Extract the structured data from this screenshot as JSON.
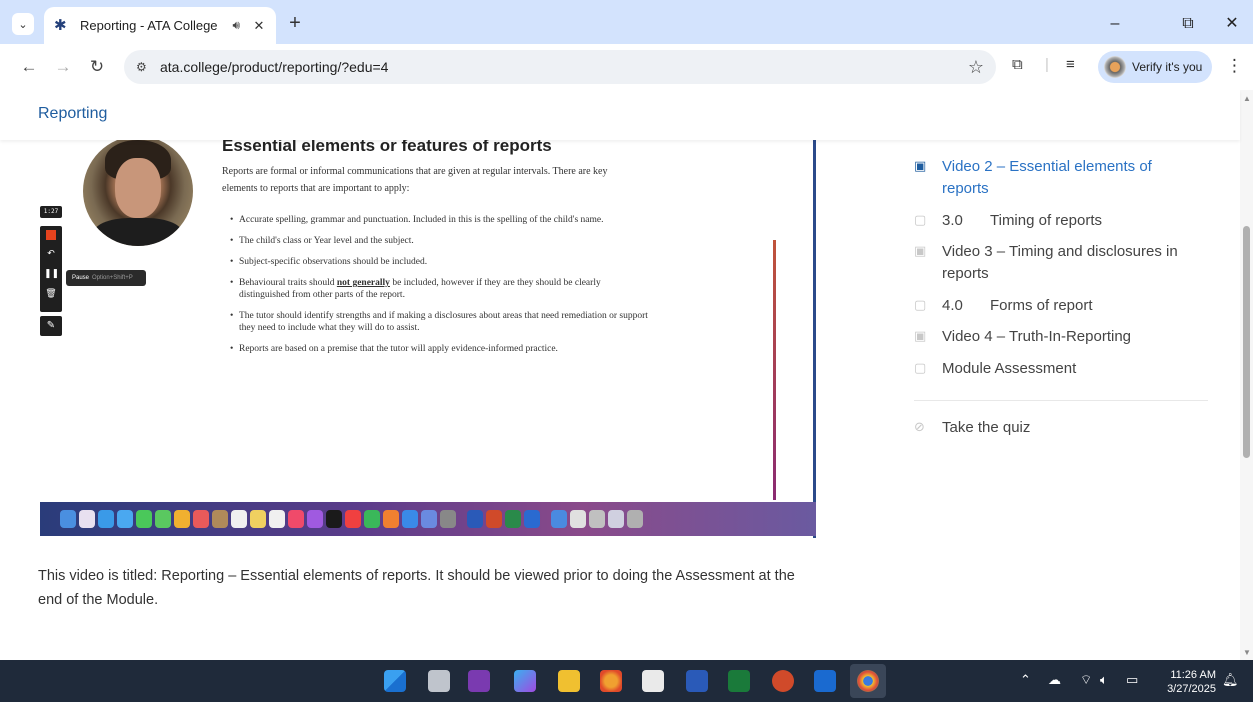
{
  "browser": {
    "tab": {
      "title": "Reporting - ATA College",
      "audio_icon": "speaker-icon",
      "close": "✕"
    },
    "url": "ata.college/product/reporting/?edu=4",
    "verify_label": "Verify it's you",
    "window_controls": {
      "minimize": "–",
      "restore": "⧉",
      "close": "✕"
    }
  },
  "page": {
    "header_title": "Reporting",
    "video": {
      "slide_title": "Essential elements or features of reports",
      "slide_intro": "Reports are formal or informal communications that are given at regular intervals. There are key elements to reports that are important to apply:",
      "bullets": [
        "Accurate spelling, grammar and punctuation. Included in this is the spelling of the child's name.",
        "The child's class or Year level and the subject.",
        "Subject-specific observations should be included.",
        "Behavioural traits should not generally be included, however if they are they should be clearly distinguished from other parts of the report.",
        "The tutor should identify strengths and if making a disclosures about areas that need remediation or support they need to include what they will do to assist.",
        "Reports are based on a premise that the tutor will apply evidence-informed practice."
      ],
      "recorder_time": "1:27",
      "tooltip_label": "Pause",
      "tooltip_shortcut": "Option+Shift+P"
    },
    "caption": "This video is titled: Reporting – Essential elements of reports. It should be viewed prior to doing the Assessment at the end of the Module."
  },
  "sidebar": {
    "items": [
      {
        "icon": "video-icon",
        "num": "",
        "label": "Video 2 – Essential elements of reports",
        "active": true
      },
      {
        "icon": "book-icon",
        "num": "3.0",
        "label": "Timing of reports",
        "active": false
      },
      {
        "icon": "video-icon",
        "num": "",
        "label": "Video 3 – Timing and disclosures in reports",
        "active": false
      },
      {
        "icon": "book-icon",
        "num": "4.0",
        "label": "Forms of report",
        "active": false
      },
      {
        "icon": "video-icon",
        "num": "",
        "label": "Video 4 – Truth-In-Reporting",
        "active": false
      },
      {
        "icon": "book-icon",
        "num": "",
        "label": "Module Assessment",
        "active": false
      },
      {
        "icon": "check-circle-icon",
        "num": "",
        "label": "Take the quiz",
        "active": false
      }
    ]
  },
  "taskbar": {
    "time": "11:26 AM",
    "date": "3/27/2025"
  },
  "colors": {
    "accent": "#2a72c4",
    "header_link": "#1f5d9f",
    "tabstrip": "#d3e3fd",
    "taskbar": "#1f2a3a"
  }
}
